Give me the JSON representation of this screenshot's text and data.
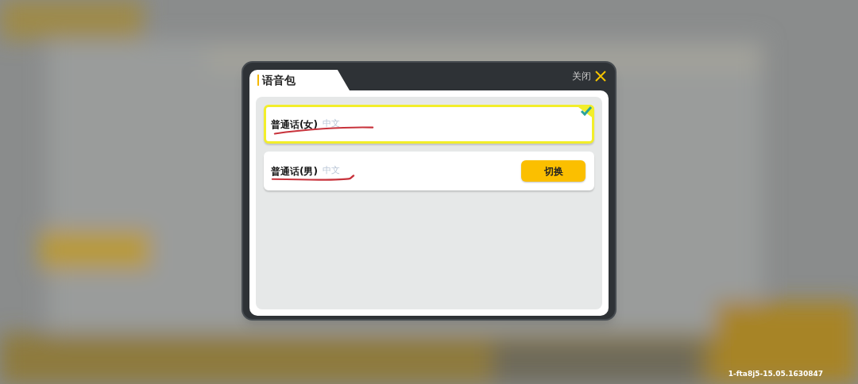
{
  "dialog": {
    "title": "语音包",
    "close_label": "关闭"
  },
  "voice_packs": [
    {
      "name": "普通话(女)",
      "language": "中文",
      "selected": true
    },
    {
      "name": "普通话(男)",
      "language": "中文",
      "selected": false,
      "action": "切换"
    }
  ],
  "version": "1-fta8j5-15.05.1630847"
}
